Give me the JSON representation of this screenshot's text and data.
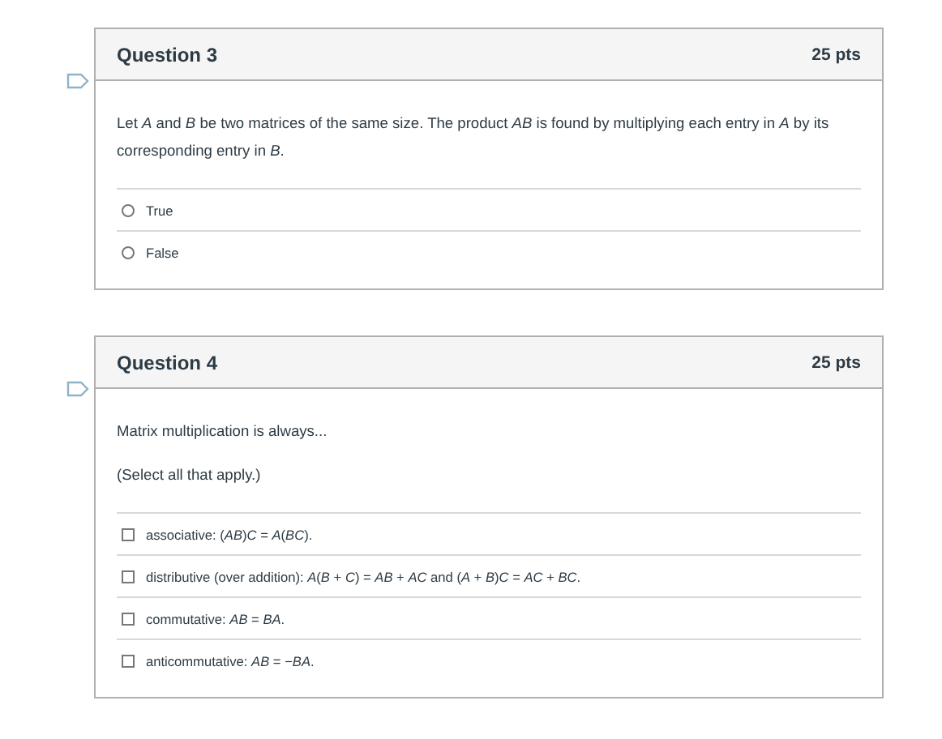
{
  "questions": [
    {
      "title": "Question 3",
      "points": "25 pts",
      "flagged": false,
      "kind": "radio",
      "prompt": [
        "Let *A* and *B* be two matrices of the same size. The product *AB* is found by multiplying each entry in *A* by its corresponding entry in *B*."
      ],
      "options": [
        {
          "label": "True",
          "selected": false
        },
        {
          "label": "False",
          "selected": false
        }
      ]
    },
    {
      "title": "Question 4",
      "points": "25 pts",
      "flagged": false,
      "kind": "checkbox",
      "prompt": [
        "Matrix multiplication is always...",
        "(Select all that apply.)"
      ],
      "options": [
        {
          "label": "associative: (*AB*)*C* = *A*(*BC*).",
          "checked": false
        },
        {
          "label": "distributive (over addition): *A*(*B* + *C*) = *AB* + *AC* and (*A* + *B*)*C* = *AC* + *BC*.",
          "checked": false
        },
        {
          "label": "commutative: *AB* = *BA*.",
          "checked": false
        },
        {
          "label": "anticommutative: *AB* = −*BA*.",
          "checked": false
        }
      ]
    }
  ]
}
